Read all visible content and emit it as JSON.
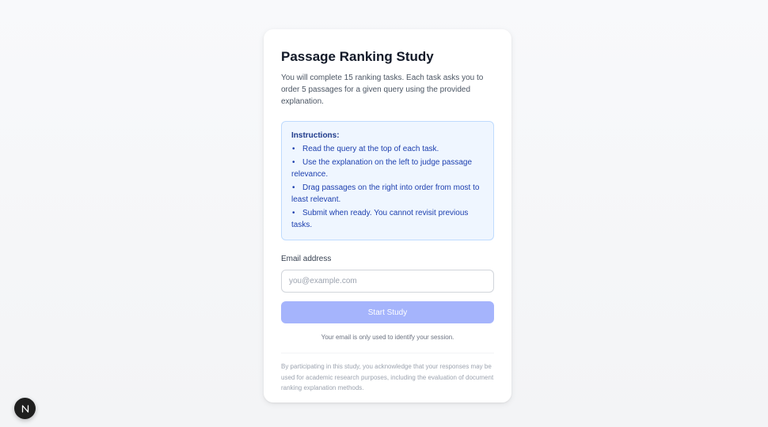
{
  "card": {
    "title": "Passage Ranking Study",
    "intro": "You will complete 15 ranking tasks. Each task asks you to order 5 passages for a given query using the provided explanation.",
    "instructions": {
      "title": "Instructions:",
      "bullet": "•",
      "items": [
        "Read the query at the top of each task.",
        "Use the explanation on the left to judge passage relevance.",
        "Drag passages on the right into order from most to least relevant.",
        "Submit when ready. You cannot revisit previous tasks."
      ]
    },
    "email": {
      "label": "Email address",
      "placeholder": "you@example.com",
      "value": ""
    },
    "start_button_label": "Start Study",
    "email_note": "Your email is only used to identify your session.",
    "consent": "By participating in this study, you acknowledge that your responses may be used for academic research purposes, including the evaluation of document ranking explanation methods."
  },
  "dev_indicator": {
    "icon": "nextjs-logo-icon",
    "letter": "N"
  },
  "colors": {
    "button_disabled": "#a5b4fc",
    "instructions_bg": "#eff6ff",
    "instructions_text": "#1e40af"
  }
}
